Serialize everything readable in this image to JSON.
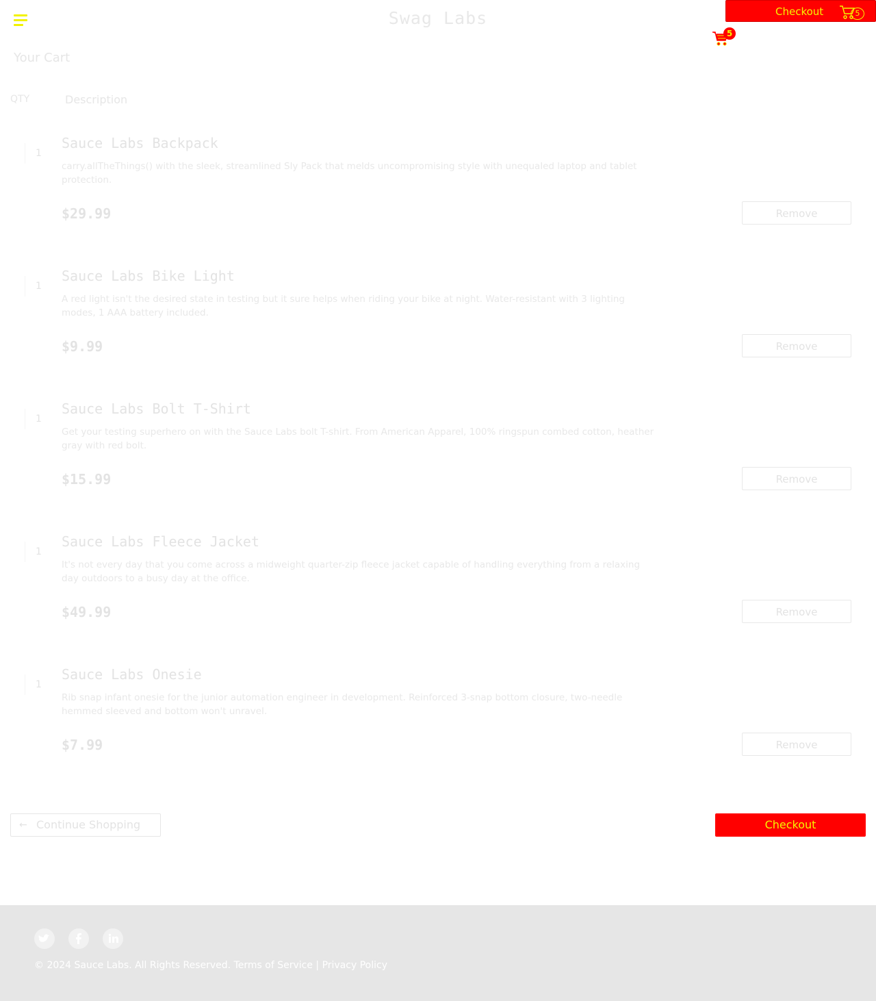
{
  "header": {
    "app_title": "Swag Labs",
    "checkout_label": "Checkout",
    "cart_count": "5"
  },
  "page": {
    "title": "Your Cart",
    "qty_header": "QTY",
    "description_header": "Description"
  },
  "items": [
    {
      "qty": "1",
      "name": "Sauce Labs Backpack",
      "description": "carry.allTheThings() with the sleek, streamlined Sly Pack that melds uncompromising style with unequaled laptop and tablet protection.",
      "price": "$29.99",
      "remove_label": "Remove"
    },
    {
      "qty": "1",
      "name": "Sauce Labs Bike Light",
      "description": "A red light isn't the desired state in testing but it sure helps when riding your bike at night. Water-resistant with 3 lighting modes, 1 AAA battery included.",
      "price": "$9.99",
      "remove_label": "Remove"
    },
    {
      "qty": "1",
      "name": "Sauce Labs Bolt T-Shirt",
      "description": "Get your testing superhero on with the Sauce Labs bolt T-shirt. From American Apparel, 100% ringspun combed cotton, heather gray with red bolt.",
      "price": "$15.99",
      "remove_label": "Remove"
    },
    {
      "qty": "1",
      "name": "Sauce Labs Fleece Jacket",
      "description": "It's not every day that you come across a midweight quarter-zip fleece jacket capable of handling everything from a relaxing day outdoors to a busy day at the office.",
      "price": "$49.99",
      "remove_label": "Remove"
    },
    {
      "qty": "1",
      "name": "Sauce Labs Onesie",
      "description": "Rib snap infant onesie for the junior automation engineer in development. Reinforced 3-snap bottom closure, two-needle hemmed sleeved and bottom won't unravel.",
      "price": "$7.99",
      "remove_label": "Remove"
    }
  ],
  "actions": {
    "continue_shopping_label": "Continue Shopping",
    "checkout_label": "Checkout"
  },
  "footer": {
    "copyright": "© 2024 Sauce Labs. All Rights Reserved.",
    "terms_label": "Terms of Service",
    "separator": "|",
    "privacy_label": "Privacy Policy",
    "social": [
      "twitter-icon",
      "facebook-icon",
      "linkedin-icon"
    ]
  },
  "colors": {
    "accent_red": "#ff0000",
    "accent_yellow": "#f5f500",
    "footer_bg": "#e6e6e6"
  }
}
